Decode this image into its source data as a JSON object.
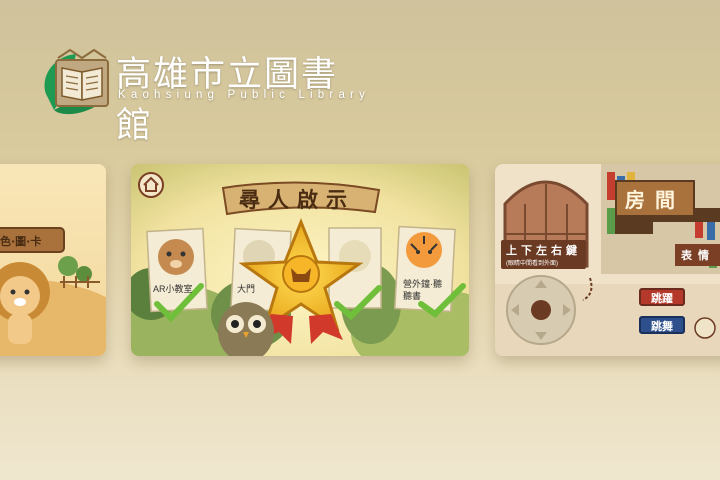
{
  "logo": {
    "title": "高雄市立圖書館",
    "subtitle": "Kaohsiung Public Library"
  },
  "cards": {
    "left": {
      "sign": "色·圖·卡"
    },
    "center": {
      "title": "尋人啟示",
      "poster_labels": [
        "AR小教室",
        "大門",
        "營外鐘·聽聽書"
      ]
    },
    "right": {
      "title": "房間",
      "sign1": "上下左右鍵",
      "sign1_sub": "(眼睛中間看到外面)",
      "sign2": "表情",
      "btn1": "跳躍",
      "btn2": "跳舞"
    }
  },
  "colors": {
    "accent_red": "#b5392a",
    "accent_blue": "#2d4f8c",
    "wood": "#7a4a22"
  }
}
